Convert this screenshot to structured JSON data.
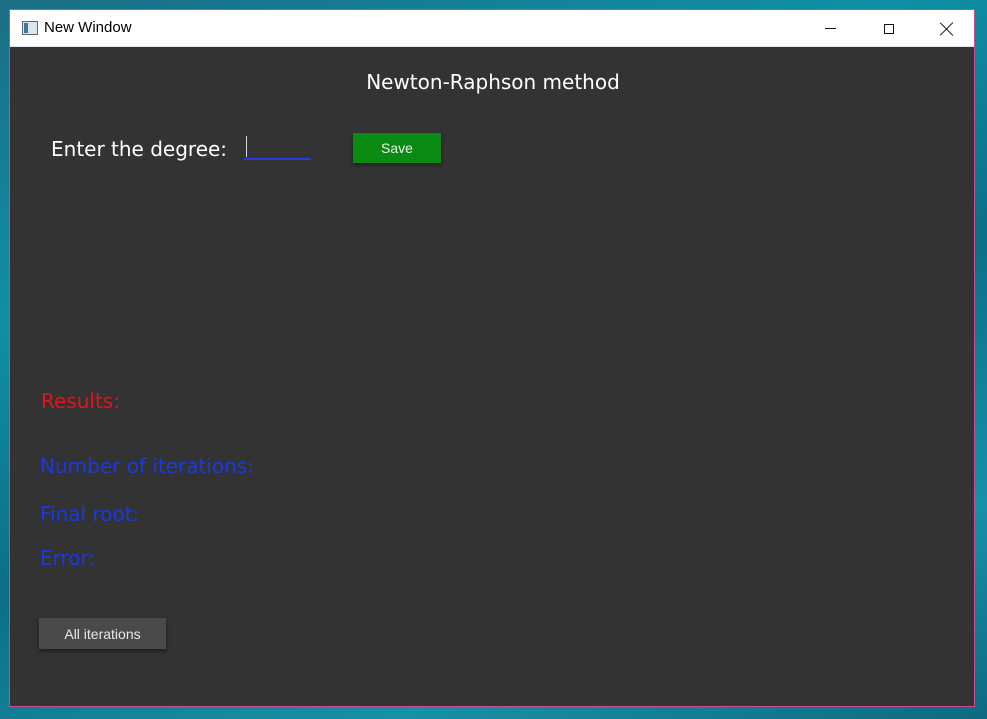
{
  "window": {
    "title": "New Window",
    "controls": {
      "minimize": "minimize-icon",
      "maximize": "maximize-icon",
      "close": "close-icon"
    }
  },
  "main": {
    "heading": "Newton-Raphson method",
    "degree_label": "Enter the degree:",
    "degree_value": "",
    "save_label": "Save",
    "results_label": "Results:",
    "iterations_label": "Number of iterations:",
    "final_root_label": "Final root:",
    "error_label": "Error:",
    "all_iterations_label": "All iterations"
  },
  "colors": {
    "background": "#333333",
    "save_button": "#0a8a12",
    "results_text": "#e0141e",
    "output_labels": "#1a3ae0",
    "input_underline": "#2a3bd8"
  }
}
